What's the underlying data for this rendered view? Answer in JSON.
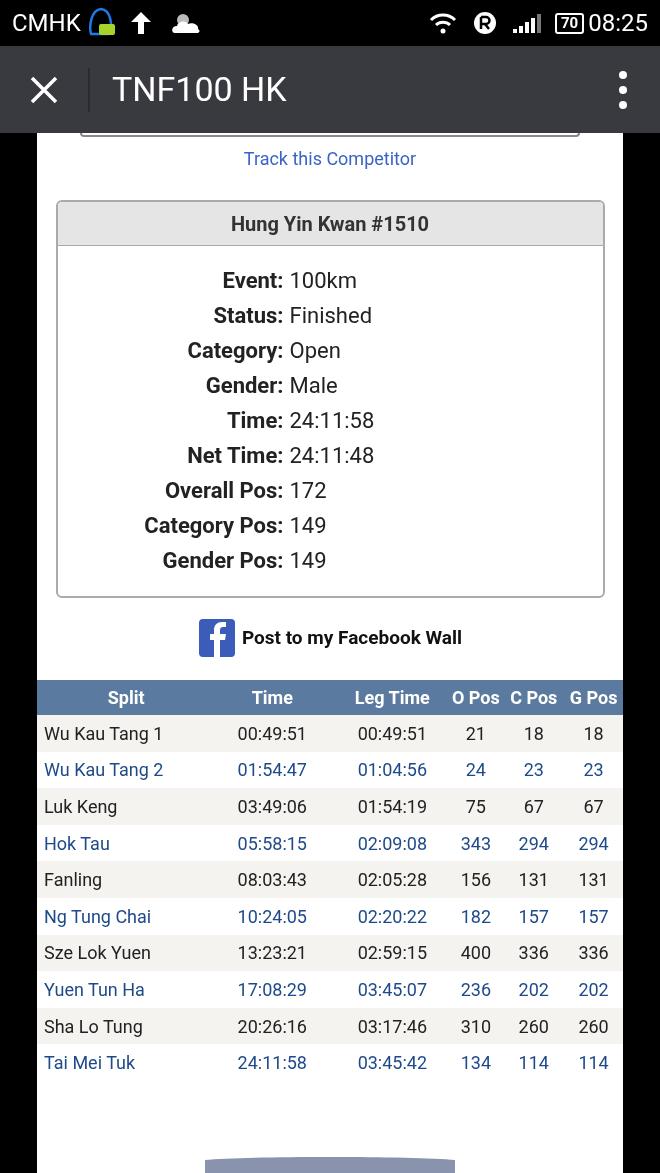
{
  "status_bar": {
    "carrier": "CMHK",
    "battery": "70",
    "time": "08:25"
  },
  "toolbar": {
    "title": "TNF100 HK"
  },
  "track_link": "Track this Competitor",
  "competitor": {
    "title": "Hung Yin Kwan #1510",
    "fields": [
      {
        "label": "Event:",
        "value": "100km"
      },
      {
        "label": "Status:",
        "value": "Finished"
      },
      {
        "label": "Category:",
        "value": "Open"
      },
      {
        "label": "Gender:",
        "value": "Male"
      },
      {
        "label": "Time:",
        "value": "24:11:58"
      },
      {
        "label": "Net Time:",
        "value": "24:11:48"
      },
      {
        "label": "Overall Pos:",
        "value": "172"
      },
      {
        "label": "Category Pos:",
        "value": "149"
      },
      {
        "label": "Gender Pos:",
        "value": "149"
      }
    ]
  },
  "facebook_button": "Post to my Facebook Wall",
  "table": {
    "columns": [
      "Split",
      "Time",
      "Leg Time",
      "O Pos",
      "C Pos",
      "G Pos"
    ],
    "rows": [
      [
        "Wu Kau Tang 1",
        "00:49:51",
        "00:49:51",
        "21",
        "18",
        "18"
      ],
      [
        "Wu Kau Tang 2",
        "01:54:47",
        "01:04:56",
        "24",
        "23",
        "23"
      ],
      [
        "Luk Keng",
        "03:49:06",
        "01:54:19",
        "75",
        "67",
        "67"
      ],
      [
        "Hok Tau",
        "05:58:15",
        "02:09:08",
        "343",
        "294",
        "294"
      ],
      [
        "Fanling",
        "08:03:43",
        "02:05:28",
        "156",
        "131",
        "131"
      ],
      [
        "Ng Tung Chai",
        "10:24:05",
        "02:20:22",
        "182",
        "157",
        "157"
      ],
      [
        "Sze Lok Yuen",
        "13:23:21",
        "02:59:15",
        "400",
        "336",
        "336"
      ],
      [
        "Yuen Tun Ha",
        "17:08:29",
        "03:45:07",
        "236",
        "202",
        "202"
      ],
      [
        "Sha Lo Tung",
        "20:26:16",
        "03:17:46",
        "310",
        "260",
        "260"
      ],
      [
        "Tai Mei Tuk",
        "24:11:58",
        "03:45:42",
        "134",
        "114",
        "114"
      ]
    ]
  }
}
